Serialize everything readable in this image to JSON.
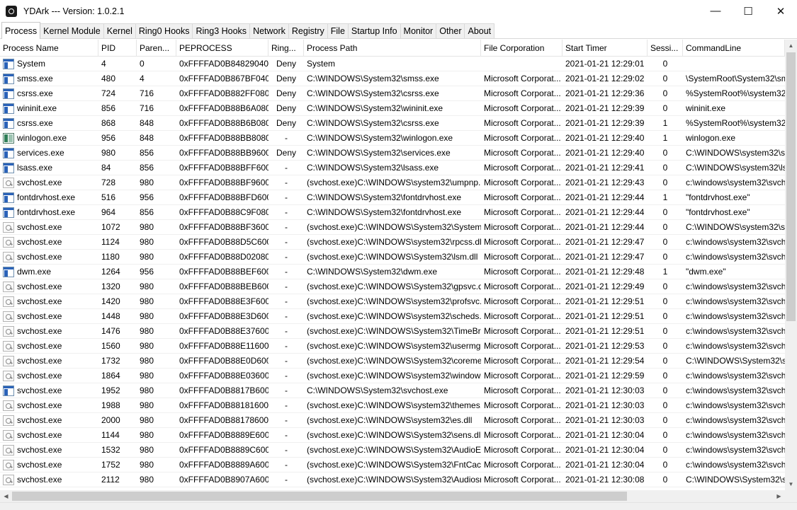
{
  "window": {
    "title": "YDArk --- Version: 1.0.2.1",
    "minimize_label": "—",
    "maximize_label": "☐",
    "close_label": "✕"
  },
  "tabs": [
    {
      "label": "Process",
      "active": true
    },
    {
      "label": "Kernel Module"
    },
    {
      "label": "Kernel"
    },
    {
      "label": "Ring0 Hooks"
    },
    {
      "label": "Ring3 Hooks"
    },
    {
      "label": "Network"
    },
    {
      "label": "Registry"
    },
    {
      "label": "File"
    },
    {
      "label": "Startup Info"
    },
    {
      "label": "Monitor"
    },
    {
      "label": "Other"
    },
    {
      "label": "About"
    }
  ],
  "columns": [
    "Process Name",
    "PID",
    "Paren...",
    "PEPROCESS",
    "Ring...",
    "Process Path",
    "File Corporation",
    "Start Timer",
    "Sessi...",
    "CommandLine"
  ],
  "scroll_glyphs": {
    "up": "▲",
    "down": "▼",
    "left": "◀",
    "right": "▶"
  },
  "processes": [
    {
      "icon": "app-icon",
      "name": "System",
      "pid": "4",
      "parent": "0",
      "eprocess": "0xFFFFAD0B84829040",
      "ring": "Deny",
      "path": "System",
      "corp": "",
      "start": "2021-01-21 12:29:01",
      "session": "0",
      "cmd": ""
    },
    {
      "icon": "app-icon",
      "name": "smss.exe",
      "pid": "480",
      "parent": "4",
      "eprocess": "0xFFFFAD0B867BF040",
      "ring": "Deny",
      "path": "C:\\WINDOWS\\System32\\smss.exe",
      "corp": "Microsoft Corporat...",
      "start": "2021-01-21 12:29:02",
      "session": "0",
      "cmd": "\\SystemRoot\\System32\\smss"
    },
    {
      "icon": "app-icon",
      "name": "csrss.exe",
      "pid": "724",
      "parent": "716",
      "eprocess": "0xFFFFAD0B882FF080",
      "ring": "Deny",
      "path": "C:\\WINDOWS\\System32\\csrss.exe",
      "corp": "Microsoft Corporat...",
      "start": "2021-01-21 12:29:36",
      "session": "0",
      "cmd": "%SystemRoot%\\system32\\c"
    },
    {
      "icon": "app-icon",
      "name": "wininit.exe",
      "pid": "856",
      "parent": "716",
      "eprocess": "0xFFFFAD0B88B6A080",
      "ring": "Deny",
      "path": "C:\\WINDOWS\\System32\\wininit.exe",
      "corp": "Microsoft Corporat...",
      "start": "2021-01-21 12:29:39",
      "session": "0",
      "cmd": "wininit.exe"
    },
    {
      "icon": "app-icon",
      "name": "csrss.exe",
      "pid": "868",
      "parent": "848",
      "eprocess": "0xFFFFAD0B88B6B080",
      "ring": "Deny",
      "path": "C:\\WINDOWS\\System32\\csrss.exe",
      "corp": "Microsoft Corporat...",
      "start": "2021-01-21 12:29:39",
      "session": "1",
      "cmd": "%SystemRoot%\\system32\\c"
    },
    {
      "icon": "winlogon-icon",
      "name": "winlogon.exe",
      "pid": "956",
      "parent": "848",
      "eprocess": "0xFFFFAD0B88BB8080",
      "ring": "-",
      "path": "C:\\WINDOWS\\System32\\winlogon.exe",
      "corp": "Microsoft Corporat...",
      "start": "2021-01-21 12:29:40",
      "session": "1",
      "cmd": "winlogon.exe"
    },
    {
      "icon": "app-icon",
      "name": "services.exe",
      "pid": "980",
      "parent": "856",
      "eprocess": "0xFFFFAD0B88BB9600",
      "ring": "Deny",
      "path": "C:\\WINDOWS\\System32\\services.exe",
      "corp": "Microsoft Corporat...",
      "start": "2021-01-21 12:29:40",
      "session": "0",
      "cmd": "C:\\WINDOWS\\system32\\ser"
    },
    {
      "icon": "app-icon",
      "name": "lsass.exe",
      "pid": "84",
      "parent": "856",
      "eprocess": "0xFFFFAD0B88BFF600",
      "ring": "-",
      "path": "C:\\WINDOWS\\System32\\lsass.exe",
      "corp": "Microsoft Corporat...",
      "start": "2021-01-21 12:29:41",
      "session": "0",
      "cmd": "C:\\WINDOWS\\system32\\lsas"
    },
    {
      "icon": "service-icon",
      "name": "svchost.exe",
      "pid": "728",
      "parent": "980",
      "eprocess": "0xFFFFAD0B88BF9600",
      "ring": "-",
      "path": "(svchost.exe)C:\\WINDOWS\\system32\\umpnp...",
      "corp": "Microsoft Corporat...",
      "start": "2021-01-21 12:29:43",
      "session": "0",
      "cmd": "c:\\windows\\system32\\svcho"
    },
    {
      "icon": "app-icon",
      "name": "fontdrvhost.exe",
      "pid": "516",
      "parent": "956",
      "eprocess": "0xFFFFAD0B88BFD600",
      "ring": "-",
      "path": "C:\\WINDOWS\\System32\\fontdrvhost.exe",
      "corp": "Microsoft Corporat...",
      "start": "2021-01-21 12:29:44",
      "session": "1",
      "cmd": "\"fontdrvhost.exe\""
    },
    {
      "icon": "app-icon",
      "name": "fontdrvhost.exe",
      "pid": "964",
      "parent": "856",
      "eprocess": "0xFFFFAD0B88C9F080",
      "ring": "-",
      "path": "C:\\WINDOWS\\System32\\fontdrvhost.exe",
      "corp": "Microsoft Corporat...",
      "start": "2021-01-21 12:29:44",
      "session": "0",
      "cmd": "\"fontdrvhost.exe\""
    },
    {
      "icon": "service-icon",
      "name": "svchost.exe",
      "pid": "1072",
      "parent": "980",
      "eprocess": "0xFFFFAD0B88BF3600",
      "ring": "-",
      "path": "(svchost.exe)C:\\WINDOWS\\System32\\System...",
      "corp": "Microsoft Corporat...",
      "start": "2021-01-21 12:29:44",
      "session": "0",
      "cmd": "C:\\WINDOWS\\system32\\svc"
    },
    {
      "icon": "service-icon",
      "name": "svchost.exe",
      "pid": "1124",
      "parent": "980",
      "eprocess": "0xFFFFAD0B88D5C600",
      "ring": "-",
      "path": "(svchost.exe)C:\\WINDOWS\\system32\\rpcss.dll",
      "corp": "Microsoft Corporat...",
      "start": "2021-01-21 12:29:47",
      "session": "0",
      "cmd": "c:\\windows\\system32\\svcho"
    },
    {
      "icon": "service-icon",
      "name": "svchost.exe",
      "pid": "1180",
      "parent": "980",
      "eprocess": "0xFFFFAD0B88D02080",
      "ring": "-",
      "path": "(svchost.exe)C:\\WINDOWS\\System32\\lsm.dll",
      "corp": "Microsoft Corporat...",
      "start": "2021-01-21 12:29:47",
      "session": "0",
      "cmd": "c:\\windows\\system32\\svcho"
    },
    {
      "icon": "app-icon",
      "name": "dwm.exe",
      "pid": "1264",
      "parent": "956",
      "eprocess": "0xFFFFAD0B88BEF600",
      "ring": "-",
      "path": "C:\\WINDOWS\\System32\\dwm.exe",
      "corp": "Microsoft Corporat...",
      "start": "2021-01-21 12:29:48",
      "session": "1",
      "cmd": "\"dwm.exe\""
    },
    {
      "icon": "service-icon",
      "name": "svchost.exe",
      "pid": "1320",
      "parent": "980",
      "eprocess": "0xFFFFAD0B88BEB600",
      "ring": "-",
      "path": "(svchost.exe)C:\\WINDOWS\\System32\\gpsvc.dll",
      "corp": "Microsoft Corporat...",
      "start": "2021-01-21 12:29:49",
      "session": "0",
      "cmd": "c:\\windows\\system32\\svcho"
    },
    {
      "icon": "service-icon",
      "name": "svchost.exe",
      "pid": "1420",
      "parent": "980",
      "eprocess": "0xFFFFAD0B88E3F600",
      "ring": "-",
      "path": "(svchost.exe)C:\\WINDOWS\\system32\\profsvc.dll",
      "corp": "Microsoft Corporat...",
      "start": "2021-01-21 12:29:51",
      "session": "0",
      "cmd": "c:\\windows\\system32\\svcho"
    },
    {
      "icon": "service-icon",
      "name": "svchost.exe",
      "pid": "1448",
      "parent": "980",
      "eprocess": "0xFFFFAD0B88E3D600",
      "ring": "-",
      "path": "(svchost.exe)C:\\WINDOWS\\system32\\scheds...",
      "corp": "Microsoft Corporat...",
      "start": "2021-01-21 12:29:51",
      "session": "0",
      "cmd": "c:\\windows\\system32\\svcho"
    },
    {
      "icon": "service-icon",
      "name": "svchost.exe",
      "pid": "1476",
      "parent": "980",
      "eprocess": "0xFFFFAD0B88E37600",
      "ring": "-",
      "path": "(svchost.exe)C:\\WINDOWS\\System32\\TimeBr...",
      "corp": "Microsoft Corporat...",
      "start": "2021-01-21 12:29:51",
      "session": "0",
      "cmd": "c:\\windows\\system32\\svcho"
    },
    {
      "icon": "service-icon",
      "name": "svchost.exe",
      "pid": "1560",
      "parent": "980",
      "eprocess": "0xFFFFAD0B88E11600",
      "ring": "-",
      "path": "(svchost.exe)C:\\WINDOWS\\system32\\usermg...",
      "corp": "Microsoft Corporat...",
      "start": "2021-01-21 12:29:53",
      "session": "0",
      "cmd": "c:\\windows\\system32\\svcho"
    },
    {
      "icon": "service-icon",
      "name": "svchost.exe",
      "pid": "1732",
      "parent": "980",
      "eprocess": "0xFFFFAD0B88E0D600",
      "ring": "-",
      "path": "(svchost.exe)C:\\WINDOWS\\System32\\coreme...",
      "corp": "Microsoft Corporat...",
      "start": "2021-01-21 12:29:54",
      "session": "0",
      "cmd": "C:\\WINDOWS\\System32\\svc"
    },
    {
      "icon": "service-icon",
      "name": "svchost.exe",
      "pid": "1864",
      "parent": "980",
      "eprocess": "0xFFFFAD0B88E03600",
      "ring": "-",
      "path": "(svchost.exe)C:\\WINDOWS\\system32\\window...",
      "corp": "Microsoft Corporat...",
      "start": "2021-01-21 12:29:59",
      "session": "0",
      "cmd": "c:\\windows\\system32\\svcho"
    },
    {
      "icon": "app-icon",
      "name": "svchost.exe",
      "pid": "1952",
      "parent": "980",
      "eprocess": "0xFFFFAD0B8817B600",
      "ring": "-",
      "path": "C:\\WINDOWS\\System32\\svchost.exe",
      "corp": "Microsoft Corporat...",
      "start": "2021-01-21 12:30:03",
      "session": "0",
      "cmd": "c:\\windows\\system32\\svcho"
    },
    {
      "icon": "service-icon",
      "name": "svchost.exe",
      "pid": "1988",
      "parent": "980",
      "eprocess": "0xFFFFAD0B88181600",
      "ring": "-",
      "path": "(svchost.exe)C:\\WINDOWS\\system32\\themes...",
      "corp": "Microsoft Corporat...",
      "start": "2021-01-21 12:30:03",
      "session": "0",
      "cmd": "c:\\windows\\system32\\svcho"
    },
    {
      "icon": "service-icon",
      "name": "svchost.exe",
      "pid": "2000",
      "parent": "980",
      "eprocess": "0xFFFFAD0B88178600",
      "ring": "-",
      "path": "(svchost.exe)C:\\WINDOWS\\system32\\es.dll",
      "corp": "Microsoft Corporat...",
      "start": "2021-01-21 12:30:03",
      "session": "0",
      "cmd": "c:\\windows\\system32\\svcho"
    },
    {
      "icon": "service-icon",
      "name": "svchost.exe",
      "pid": "1144",
      "parent": "980",
      "eprocess": "0xFFFFAD0B8889E600",
      "ring": "-",
      "path": "(svchost.exe)C:\\WINDOWS\\System32\\sens.dll",
      "corp": "Microsoft Corporat...",
      "start": "2021-01-21 12:30:04",
      "session": "0",
      "cmd": "c:\\windows\\system32\\svcho"
    },
    {
      "icon": "service-icon",
      "name": "svchost.exe",
      "pid": "1532",
      "parent": "980",
      "eprocess": "0xFFFFAD0B8889C600",
      "ring": "-",
      "path": "(svchost.exe)C:\\WINDOWS\\System32\\AudioE...",
      "corp": "Microsoft Corporat...",
      "start": "2021-01-21 12:30:04",
      "session": "0",
      "cmd": "c:\\windows\\system32\\svcho"
    },
    {
      "icon": "service-icon",
      "name": "svchost.exe",
      "pid": "1752",
      "parent": "980",
      "eprocess": "0xFFFFAD0B8889A600",
      "ring": "-",
      "path": "(svchost.exe)C:\\WINDOWS\\System32\\FntCac...",
      "corp": "Microsoft Corporat...",
      "start": "2021-01-21 12:30:04",
      "session": "0",
      "cmd": "c:\\windows\\system32\\svcho"
    },
    {
      "icon": "service-icon",
      "name": "svchost.exe",
      "pid": "2112",
      "parent": "980",
      "eprocess": "0xFFFFAD0B8907A600",
      "ring": "-",
      "path": "(svchost.exe)C:\\WINDOWS\\System32\\Audiosr...",
      "corp": "Microsoft Corporat...",
      "start": "2021-01-21 12:30:08",
      "session": "0",
      "cmd": "C:\\WINDOWS\\System32\\svc"
    }
  ]
}
